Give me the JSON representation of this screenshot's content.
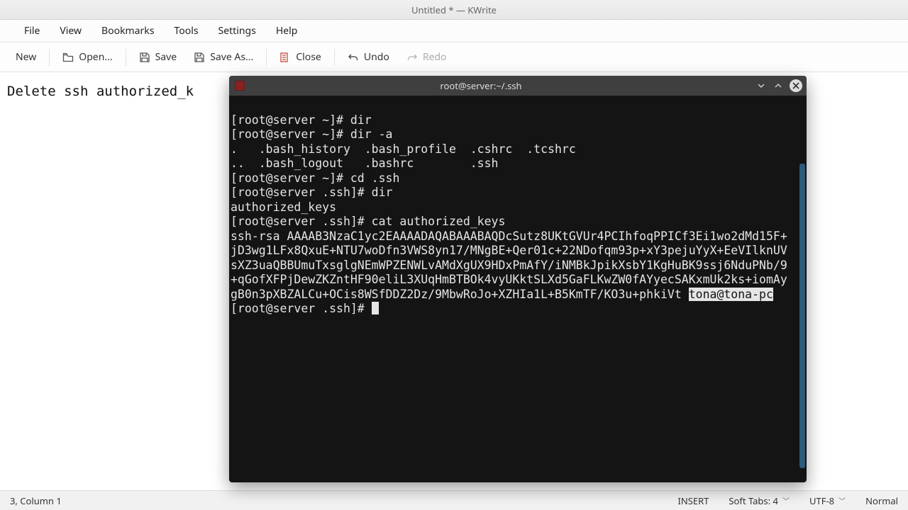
{
  "window_title": "Untitled * — KWrite",
  "menu": {
    "file": "File",
    "view": "View",
    "bookmarks": "Bookmarks",
    "tools": "Tools",
    "settings": "Settings",
    "help": "Help"
  },
  "toolbar": {
    "new": "New",
    "open": "Open...",
    "save": "Save",
    "save_as": "Save As...",
    "close": "Close",
    "undo": "Undo",
    "redo": "Redo"
  },
  "editor_text": "Delete ssh authorized_k",
  "status": {
    "cursor": "3, Column 1",
    "mode": "INSERT",
    "tabs": "Soft Tabs: 4",
    "encoding": "UTF-8",
    "state": "Normal"
  },
  "terminal": {
    "title": "root@server:~/.ssh",
    "lines": [
      "[root@server ~]# dir",
      "[root@server ~]# dir -a",
      ".   .bash_history  .bash_profile  .cshrc  .tcshrc",
      "..  .bash_logout   .bashrc        .ssh",
      "[root@server ~]# cd .ssh",
      "[root@server .ssh]# dir",
      "authorized_keys",
      "[root@server .ssh]# cat authorized_keys"
    ],
    "key_blob": "ssh-rsa AAAAB3NzaC1yc2EAAAADAQABAAABAQDcSutz8UKtGVUr4PCIhfoqPPICf3Ei1wo2dMd15F+jD3wg1LFx8QxuE+NTU7woDfn3VWS8yn17/MNgBE+Qer01c+22NDofqm93p+xY3pejuYyX+EeVIlknUVsXZ3uaQBBUmuTxsglgNEmWPZENWLvAMdXgUX9HDxPmAfY/iNMBkJpikXsbY1KgHuBK9ssj6NduPNb/9+qGofXFPjDewZKZntHF90eliL3XUqHmBTBOk4vyUKktSLXd5GaFLKwZW0fAYyecSAKxmUk2ks+iomAygB0n3pXBZALCu+OCis8WSfDDZ2Dz/9MbwRoJo+XZHIa1L+B5KmTF/KO3u+phkiVt ",
    "key_hl": "tona@tona-pc",
    "final_prompt": "[root@server .ssh]# "
  }
}
